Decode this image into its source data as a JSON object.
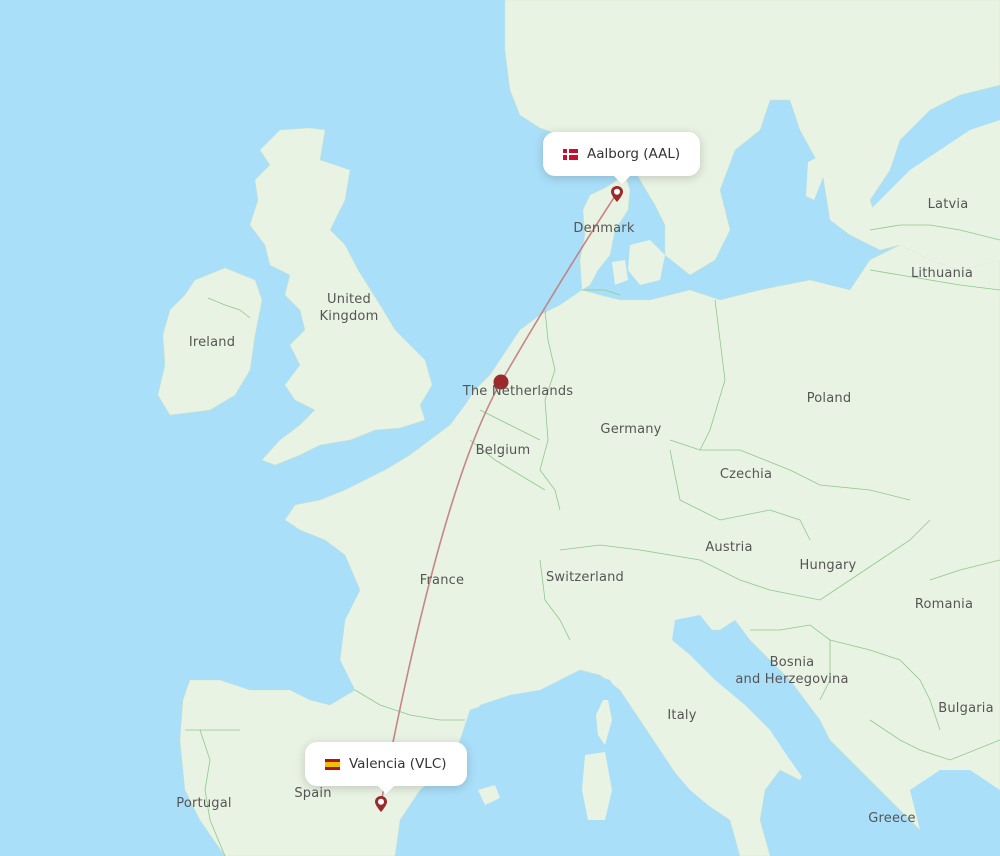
{
  "map": {
    "type": "flight-route-map",
    "colors": {
      "water": "#aadff9",
      "land": "#e9f3e3",
      "border": "#8cc98a",
      "route": "#c27a7a",
      "marker": "#9b2a2a"
    },
    "origin": {
      "city": "Aalborg",
      "code": "AAL",
      "label": "Aalborg (AAL)",
      "country_flag": "denmark-flag"
    },
    "destination": {
      "city": "Valencia",
      "code": "VLC",
      "label": "Valencia (VLC)",
      "country_flag": "spain-flag"
    },
    "waypoint_icon": "aircraft-position-dot",
    "country_labels": [
      {
        "id": "ireland",
        "text": "Ireland"
      },
      {
        "id": "uk-1",
        "text": "United"
      },
      {
        "id": "uk-2",
        "text": "Kingdom"
      },
      {
        "id": "denmark",
        "text": "Denmark"
      },
      {
        "id": "netherlands",
        "text": "The Netherlands"
      },
      {
        "id": "belgium",
        "text": "Belgium"
      },
      {
        "id": "germany",
        "text": "Germany"
      },
      {
        "id": "poland",
        "text": "Poland"
      },
      {
        "id": "latvia",
        "text": "Latvia"
      },
      {
        "id": "lithuania",
        "text": "Lithuania"
      },
      {
        "id": "czechia",
        "text": "Czechia"
      },
      {
        "id": "austria",
        "text": "Austria"
      },
      {
        "id": "hungary",
        "text": "Hungary"
      },
      {
        "id": "romania",
        "text": "Romania"
      },
      {
        "id": "switzerland",
        "text": "Switzerland"
      },
      {
        "id": "france",
        "text": "France"
      },
      {
        "id": "bosnia-1",
        "text": "Bosnia"
      },
      {
        "id": "bosnia-2",
        "text": "and Herzegovina"
      },
      {
        "id": "italy",
        "text": "Italy"
      },
      {
        "id": "bulgaria",
        "text": "Bulgaria"
      },
      {
        "id": "portugal",
        "text": "Portugal"
      },
      {
        "id": "spain",
        "text": "Spain"
      },
      {
        "id": "greece",
        "text": "Greece"
      }
    ]
  }
}
